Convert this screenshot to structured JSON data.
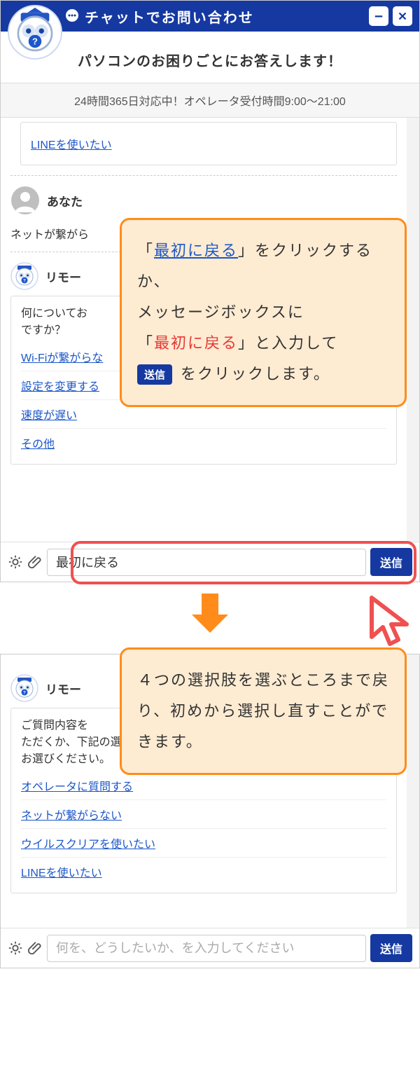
{
  "header": {
    "title": "チャットでお問い合わせ"
  },
  "subheader": "パソコンのお困りごとにお答えします！",
  "hours": "24時間365日対応中！オペレータ受付時間9:00～21:00",
  "top_card_link": "LINEを使いたい",
  "user": {
    "name": "あなた",
    "message": "ネットが繋がら"
  },
  "bot_name1": "リモー",
  "question_card": {
    "prompt_line1": "何についてお",
    "prompt_line2": "ですか？",
    "options": [
      "Wi-Fiが繋がらな",
      "設定を変更する",
      "速度が遅い",
      "その他"
    ]
  },
  "input1": {
    "value": "最初に戻る"
  },
  "send_label": "送信",
  "callout1": {
    "t1": "「",
    "link1": "最初に戻る",
    "t2": "」をクリックするか、",
    "line2": "メッセージボックスに",
    "t3": "「",
    "red1": "最初に戻る",
    "t4": "」と入力して",
    "t5": "をクリックします。"
  },
  "callout2": "４つの選択肢を選ぶところまで戻り、初めから選択し直すことができます。",
  "bot_name2": "リモー",
  "question_card2": {
    "prompt": "ご質問内容を\nただくか、下記\nお選びください。",
    "p1": "ご質問内容を",
    "p2": "ただくか、下記の選択肢",
    "p3": "お選びください。",
    "options": [
      "オペレータに質問する",
      "ネットが繋がらない",
      "ウイルスクリアを使いたい",
      "LINEを使いたい"
    ]
  },
  "input2": {
    "placeholder": "何を、どうしたいか、を入力してください"
  }
}
